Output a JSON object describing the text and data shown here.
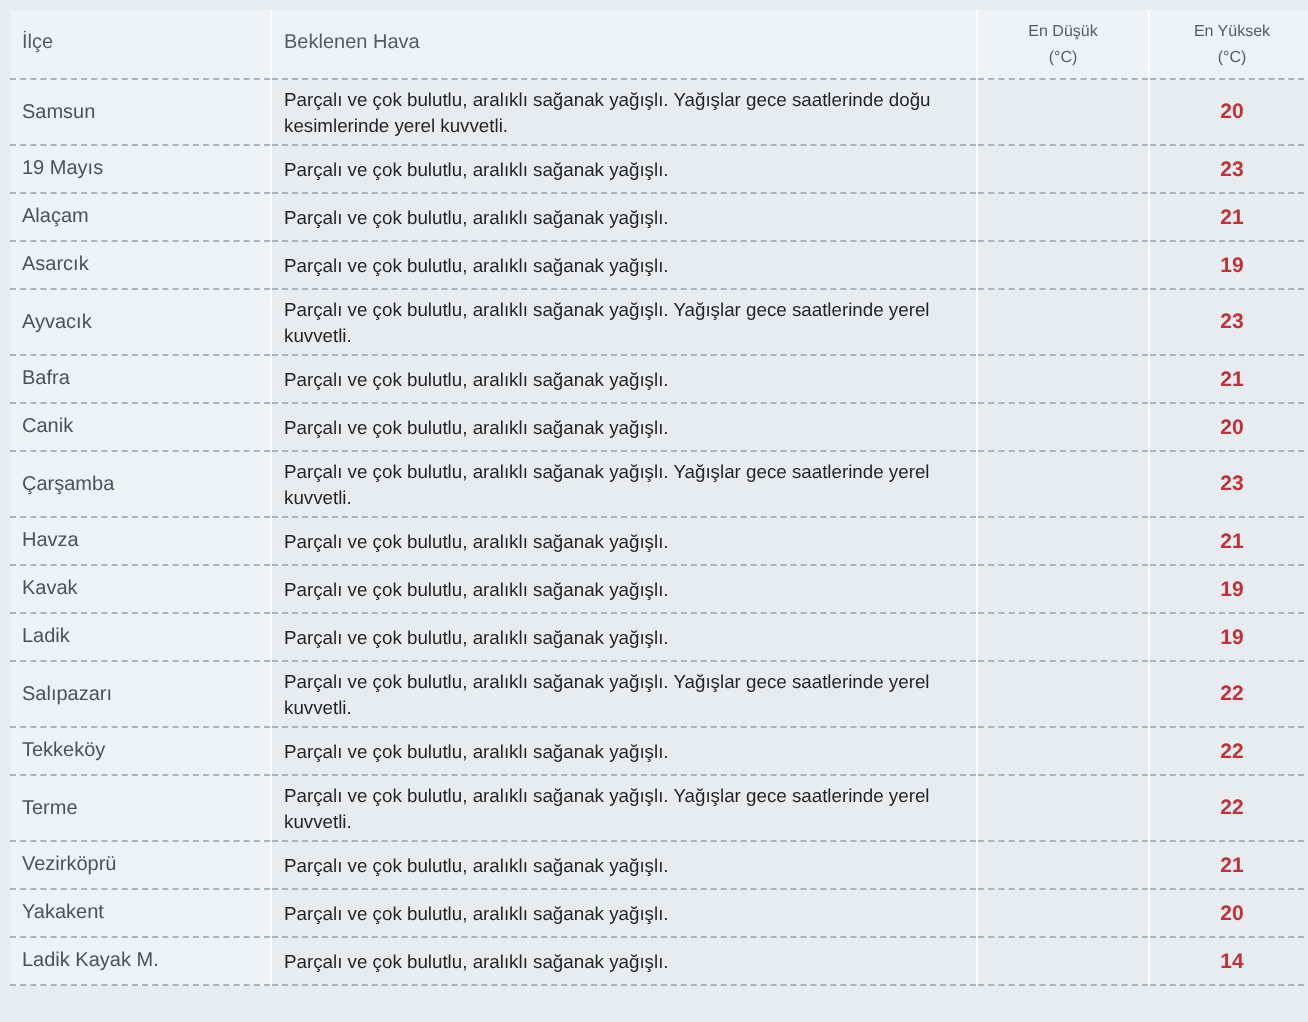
{
  "table": {
    "columns": [
      {
        "label": "İlçe"
      },
      {
        "label": "Beklenen Hava"
      },
      {
        "label": "En Düşük",
        "unit": "(°C)"
      },
      {
        "label": "En Yüksek",
        "unit": "(°C)"
      }
    ],
    "rows": [
      {
        "district": "Samsun",
        "forecast": "Parçalı ve çok bulutlu, aralıklı sağanak yağışlı. Yağışlar gece saatlerinde doğu kesimlerinde yerel kuvvetli.",
        "high": "20"
      },
      {
        "district": "19 Mayıs",
        "forecast": "Parçalı ve çok bulutlu, aralıklı sağanak yağışlı.",
        "high": "23"
      },
      {
        "district": "Alaçam",
        "forecast": "Parçalı ve çok bulutlu, aralıklı sağanak yağışlı.",
        "high": "21"
      },
      {
        "district": "Asarcık",
        "forecast": "Parçalı ve çok bulutlu, aralıklı sağanak yağışlı.",
        "high": "19"
      },
      {
        "district": "Ayvacık",
        "forecast": "Parçalı ve çok bulutlu, aralıklı sağanak yağışlı. Yağışlar gece saatlerinde yerel kuvvetli.",
        "high": "23"
      },
      {
        "district": "Bafra",
        "forecast": "Parçalı ve çok bulutlu, aralıklı sağanak yağışlı.",
        "high": "21"
      },
      {
        "district": "Canik",
        "forecast": "Parçalı ve çok bulutlu, aralıklı sağanak yağışlı.",
        "high": "20"
      },
      {
        "district": "Çarşamba",
        "forecast": "Parçalı ve çok bulutlu, aralıklı sağanak yağışlı. Yağışlar gece saatlerinde yerel kuvvetli.",
        "high": "23"
      },
      {
        "district": "Havza",
        "forecast": "Parçalı ve çok bulutlu, aralıklı sağanak yağışlı.",
        "high": "21"
      },
      {
        "district": "Kavak",
        "forecast": "Parçalı ve çok bulutlu, aralıklı sağanak yağışlı.",
        "high": "19"
      },
      {
        "district": "Ladik",
        "forecast": "Parçalı ve çok bulutlu, aralıklı sağanak yağışlı.",
        "high": "19"
      },
      {
        "district": "Salıpazarı",
        "forecast": "Parçalı ve çok bulutlu, aralıklı sağanak yağışlı. Yağışlar gece saatlerinde yerel kuvvetli.",
        "high": "22"
      },
      {
        "district": "Tekkeköy",
        "forecast": "Parçalı ve çok bulutlu, aralıklı sağanak yağışlı.",
        "high": "22"
      },
      {
        "district": "Terme",
        "forecast": "Parçalı ve çok bulutlu, aralıklı sağanak yağışlı. Yağışlar gece saatlerinde yerel kuvvetli.",
        "high": "22"
      },
      {
        "district": "Vezirköprü",
        "forecast": "Parçalı ve çok bulutlu, aralıklı sağanak yağışlı.",
        "high": "21"
      },
      {
        "district": "Yakakent",
        "forecast": "Parçalı ve çok bulutlu, aralıklı sağanak yağışlı.",
        "high": "20"
      },
      {
        "district": "Ladik Kayak M.",
        "forecast": "Parçalı ve çok bulutlu, aralıklı sağanak yağışlı.",
        "high": "14"
      }
    ]
  }
}
